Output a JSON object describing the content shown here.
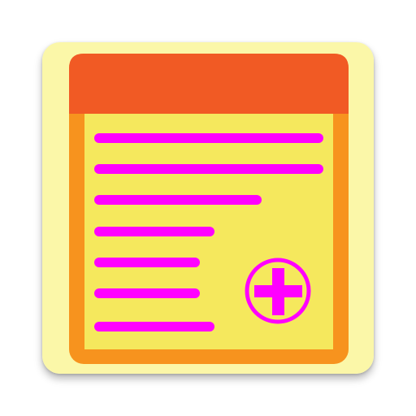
{
  "icon": {
    "name": "notepad-add-icon",
    "colors": {
      "background": "#fbf7a8",
      "header": "#f15a24",
      "page_border": "#f7931e",
      "page": "#f5e85d",
      "text_lines": "#ff00ff",
      "add_symbol": "#ff00ff"
    },
    "text_line_count": 7,
    "add_symbol": "plus-in-circle"
  }
}
